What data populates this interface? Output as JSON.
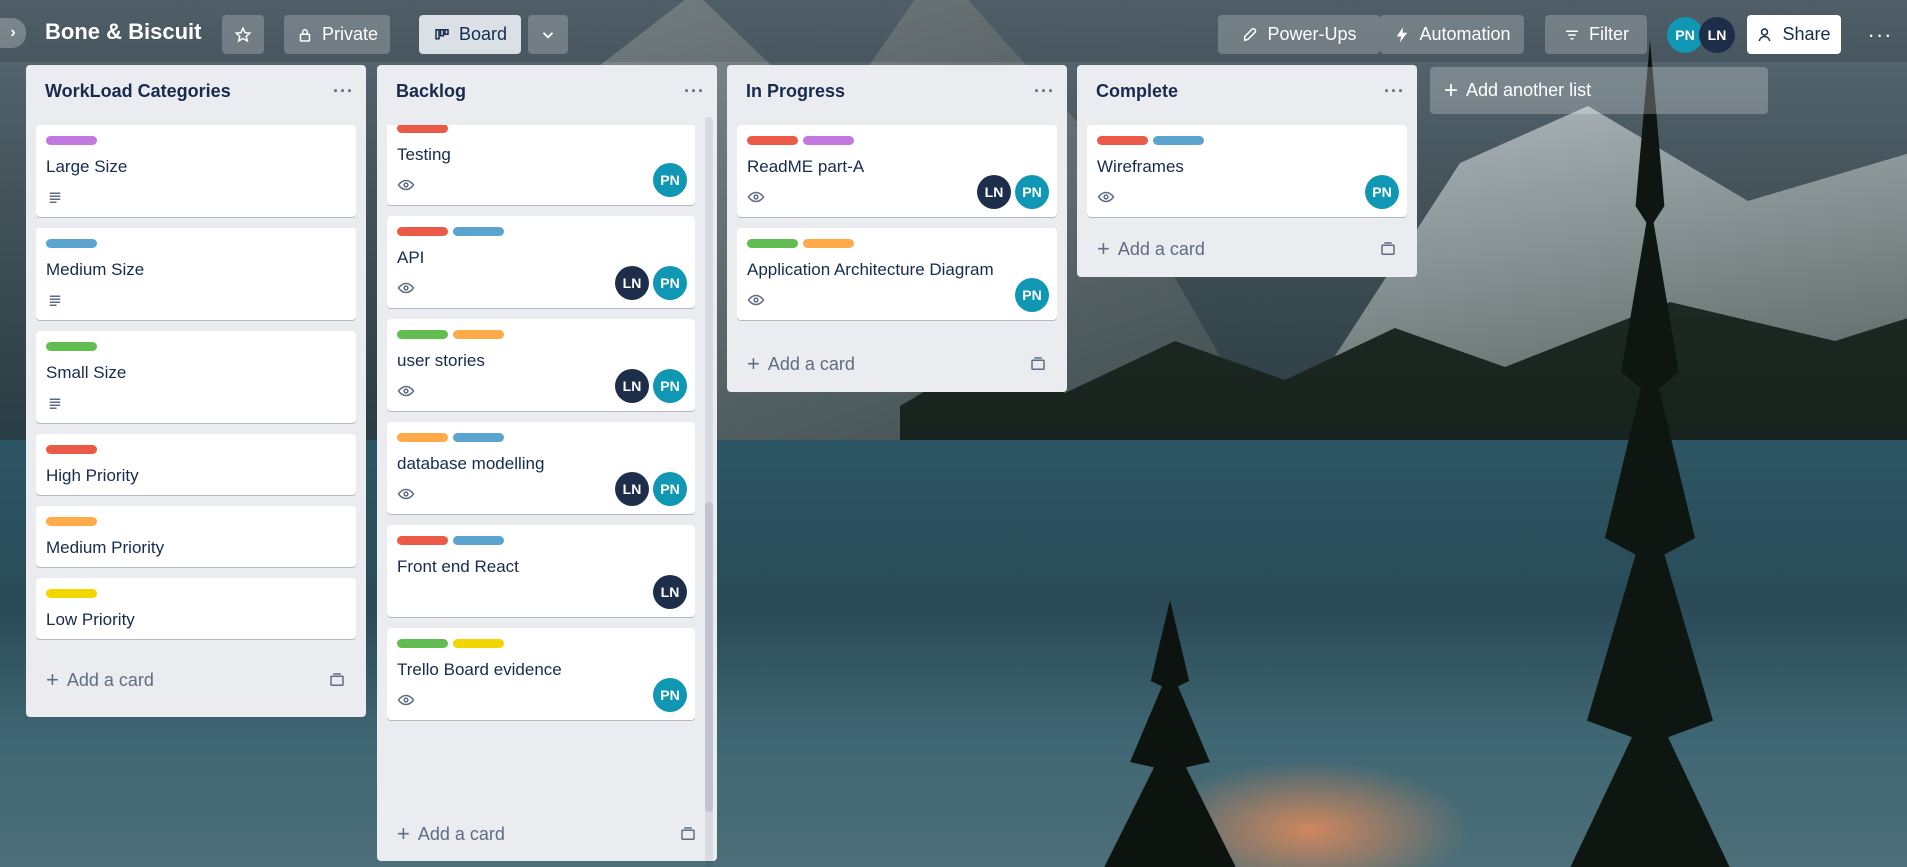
{
  "board": {
    "title": "Bone & Biscuit",
    "visibility": "Private",
    "view": "Board",
    "power_ups": "Power-Ups",
    "automation": "Automation",
    "filter": "Filter",
    "share": "Share",
    "members": [
      "PN",
      "LN"
    ]
  },
  "colors": {
    "red": "#eb5a46",
    "purple": "#c377e0",
    "blue": "#5ba4cf",
    "green": "#61bd4f",
    "orange": "#ffab4a",
    "yellow": "#f2d600",
    "pn_avatar": "#0f97b3",
    "ln_avatar": "#1e2e4a"
  },
  "add_list_label": "Add another list",
  "add_card_label": "Add a card",
  "lists": [
    {
      "title": "WorkLoad Categories",
      "cards": [
        {
          "title": "Large Size",
          "labels": [
            "purple"
          ],
          "badge": "description",
          "members": []
        },
        {
          "title": "Medium Size",
          "labels": [
            "blue"
          ],
          "badge": "description",
          "members": []
        },
        {
          "title": "Small Size",
          "labels": [
            "green"
          ],
          "badge": "description",
          "members": []
        },
        {
          "title": "High Priority",
          "labels": [
            "red"
          ],
          "badge": null,
          "members": []
        },
        {
          "title": "Medium Priority",
          "labels": [
            "orange"
          ],
          "badge": null,
          "members": []
        },
        {
          "title": "Low Priority",
          "labels": [
            "yellow"
          ],
          "badge": null,
          "members": []
        }
      ]
    },
    {
      "title": "Backlog",
      "cards": [
        {
          "title": "Testing",
          "labels": [
            "red"
          ],
          "badge": "watch",
          "members": [
            "PN"
          ]
        },
        {
          "title": "API",
          "labels": [
            "red",
            "blue"
          ],
          "badge": "watch",
          "members": [
            "LN",
            "PN"
          ]
        },
        {
          "title": "user stories",
          "labels": [
            "green",
            "orange"
          ],
          "badge": "watch",
          "members": [
            "LN",
            "PN"
          ]
        },
        {
          "title": "database modelling",
          "labels": [
            "orange",
            "blue"
          ],
          "badge": "watch",
          "members": [
            "LN",
            "PN"
          ]
        },
        {
          "title": "Front end React",
          "labels": [
            "red",
            "blue"
          ],
          "badge": null,
          "members": [
            "LN"
          ]
        },
        {
          "title": "Trello Board evidence",
          "labels": [
            "green",
            "yellow"
          ],
          "badge": "watch",
          "members": [
            "PN"
          ]
        }
      ]
    },
    {
      "title": "In Progress",
      "cards": [
        {
          "title": "ReadME part-A",
          "labels": [
            "red",
            "purple"
          ],
          "badge": "watch",
          "members": [
            "LN",
            "PN"
          ]
        },
        {
          "title": "Application Architecture Diagram",
          "labels": [
            "green",
            "orange"
          ],
          "badge": "watch",
          "members": [
            "PN"
          ]
        }
      ]
    },
    {
      "title": "Complete",
      "cards": [
        {
          "title": "Wireframes",
          "labels": [
            "red",
            "blue"
          ],
          "badge": "watch",
          "members": [
            "PN"
          ]
        }
      ]
    }
  ]
}
